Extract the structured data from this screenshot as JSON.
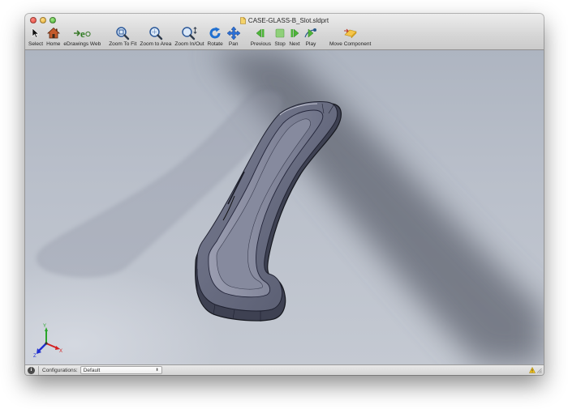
{
  "window": {
    "title": "CASE-GLASS-B_Slot.sldprt"
  },
  "toolbar": {
    "items": [
      {
        "id": "select",
        "label": "Select",
        "icon": "arrow-pointer-icon"
      },
      {
        "id": "home",
        "label": "Home",
        "icon": "home-icon"
      },
      {
        "id": "edrawings-web",
        "label": "eDrawings Web",
        "icon": "edrawings-web-icon"
      },
      {
        "id": "zoom-to-fit",
        "label": "Zoom To Fit",
        "icon": "zoom-to-fit-icon"
      },
      {
        "id": "zoom-to-area",
        "label": "Zoom to Area",
        "icon": "zoom-to-area-icon"
      },
      {
        "id": "zoom-in-out",
        "label": "Zoom In/Out",
        "icon": "zoom-in-out-icon"
      },
      {
        "id": "rotate",
        "label": "Rotate",
        "icon": "rotate-icon"
      },
      {
        "id": "pan",
        "label": "Pan",
        "icon": "pan-icon"
      },
      {
        "id": "previous",
        "label": "Previous",
        "icon": "previous-icon"
      },
      {
        "id": "stop",
        "label": "Stop",
        "icon": "stop-icon"
      },
      {
        "id": "next",
        "label": "Next",
        "icon": "next-icon"
      },
      {
        "id": "play",
        "label": "Play",
        "icon": "play-icon"
      },
      {
        "id": "move-component",
        "label": "Move Component",
        "icon": "move-component-icon"
      }
    ]
  },
  "triad": {
    "x": "X",
    "y": "Y",
    "z": "Z"
  },
  "statusbar": {
    "configurations_label": "Configurations:",
    "configuration_value": "Default"
  },
  "colors": {
    "viewport_top": "#aeb5c1",
    "part_body": "#6b6f84",
    "part_edge": "#1f2130",
    "triad_x": "#d42020",
    "triad_y": "#2aa52a",
    "triad_z": "#2030d0"
  }
}
